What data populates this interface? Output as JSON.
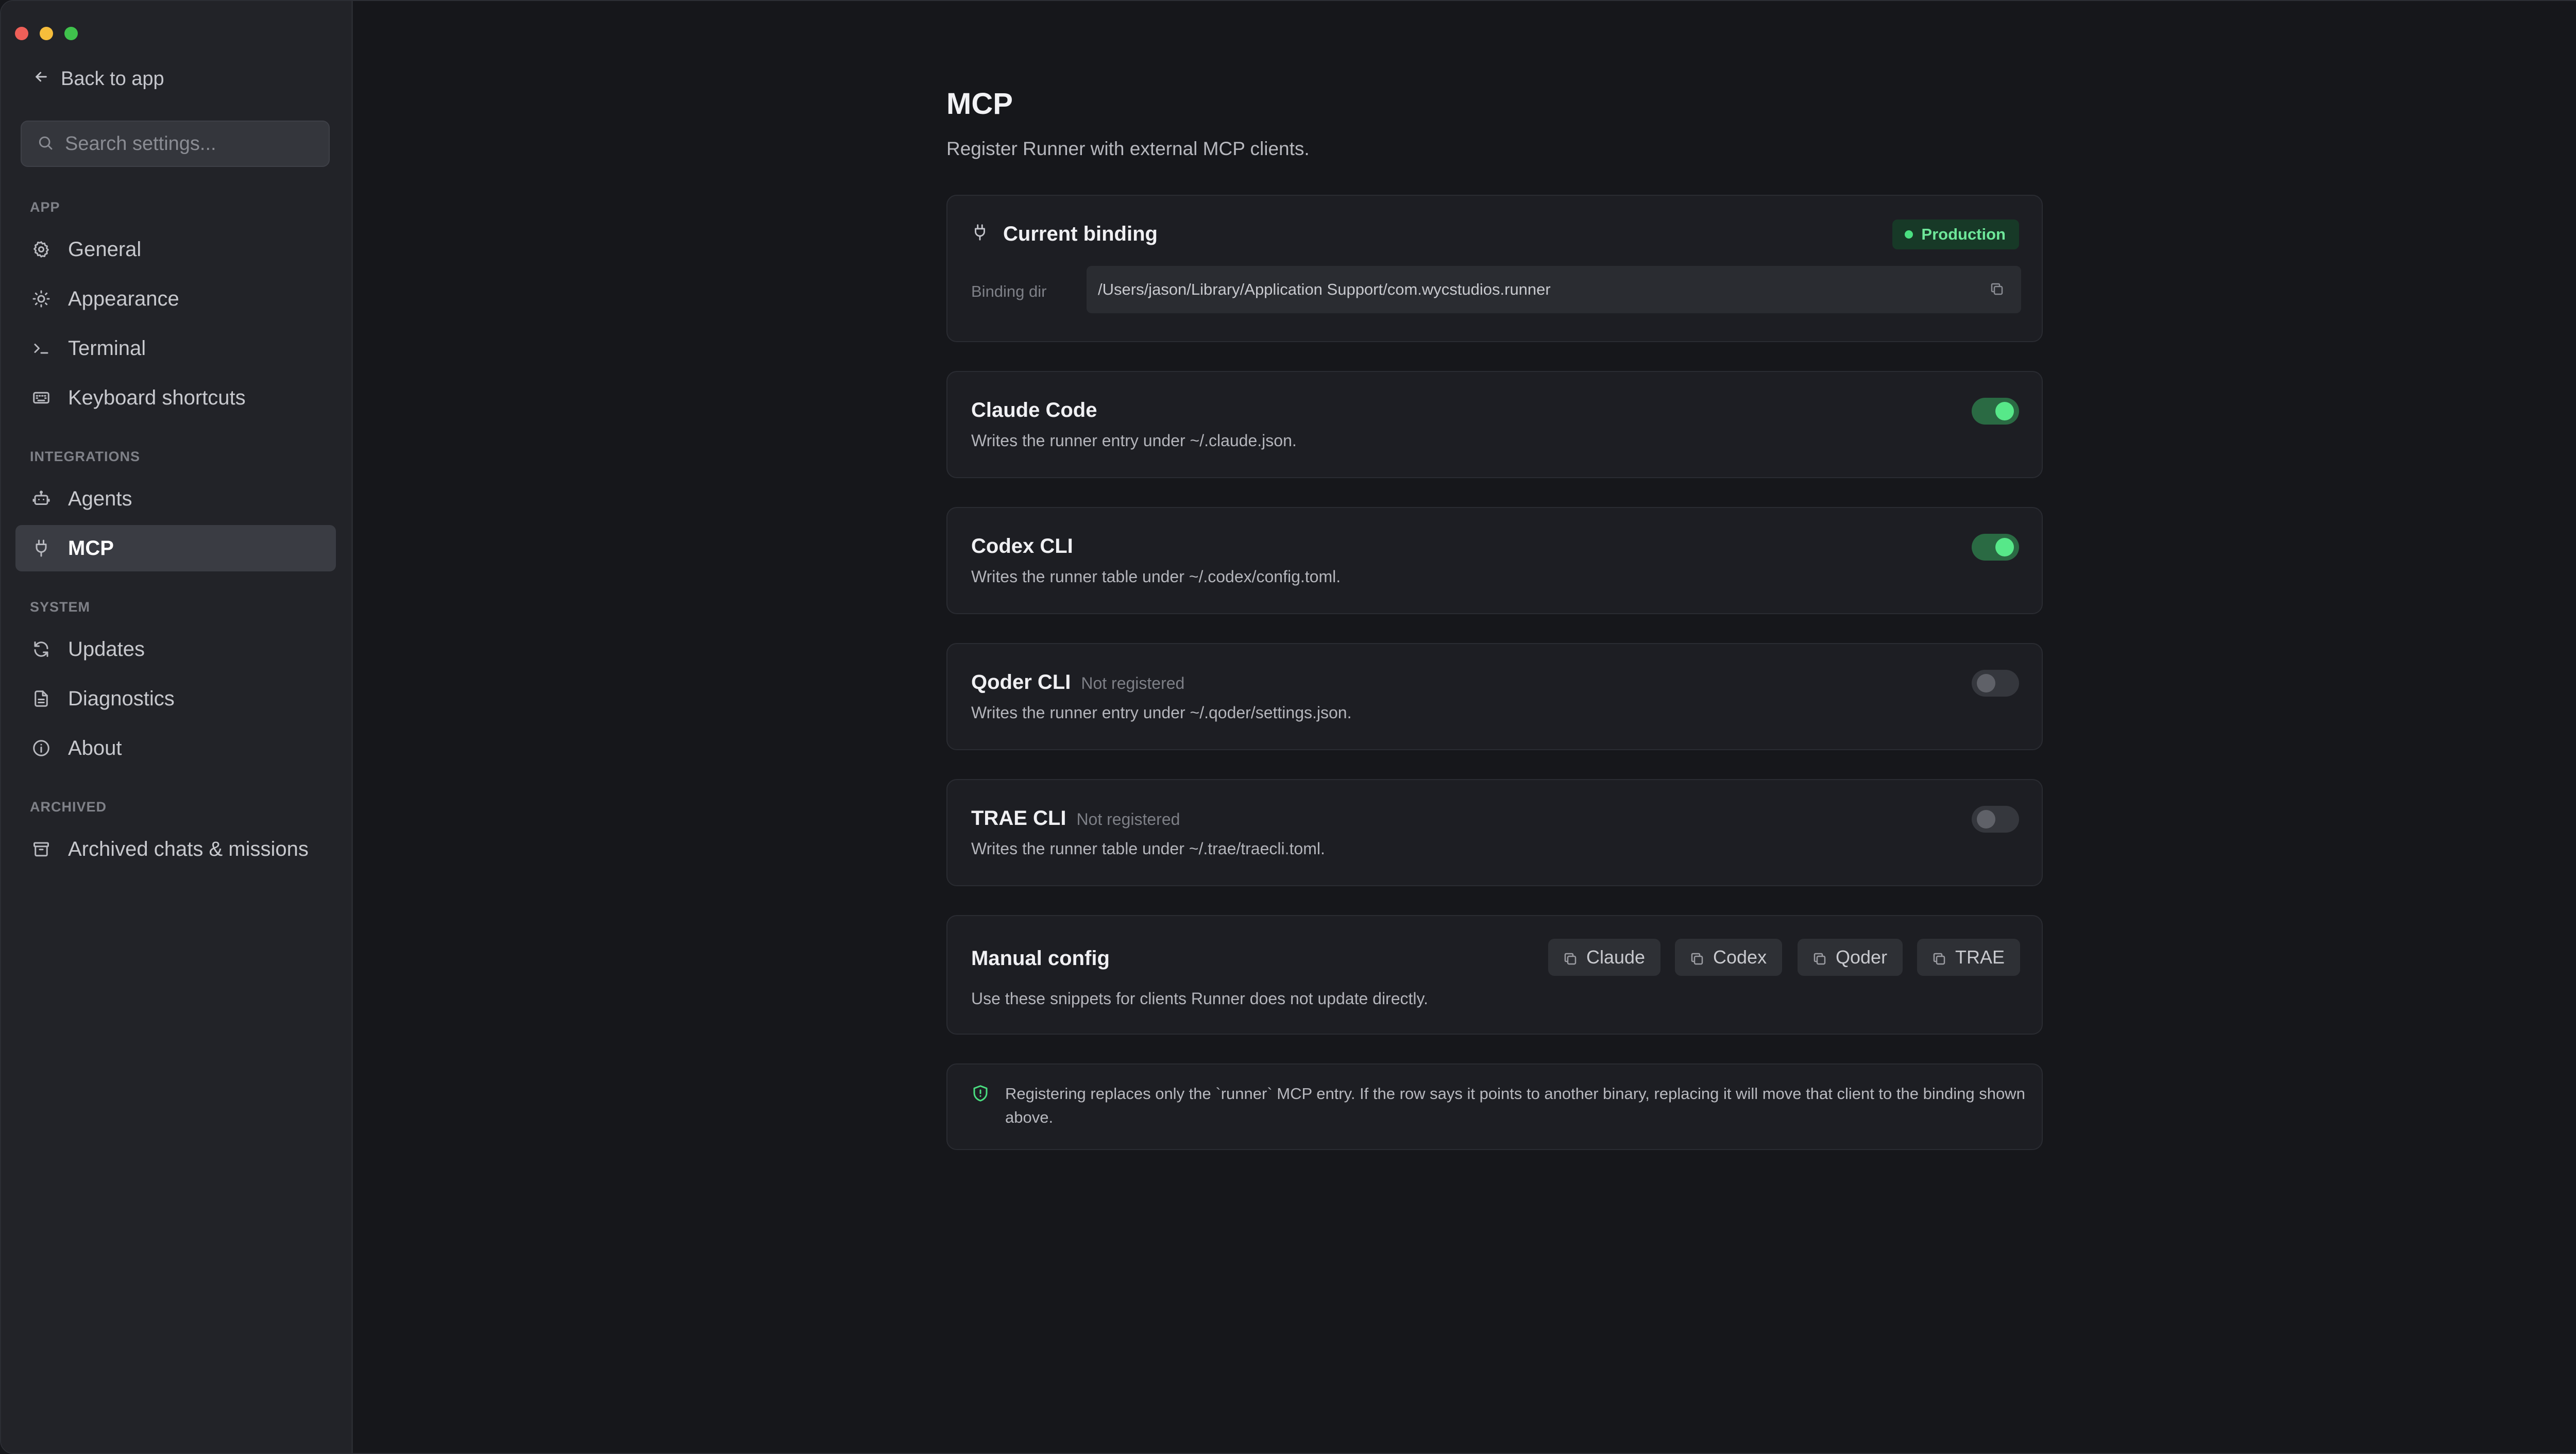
{
  "sidebar": {
    "back_label": "Back to app",
    "search_placeholder": "Search settings...",
    "sections": {
      "app": "APP",
      "integrations": "INTEGRATIONS",
      "system": "SYSTEM",
      "archived": "ARCHIVED"
    },
    "items": {
      "general": "General",
      "appearance": "Appearance",
      "terminal": "Terminal",
      "keyboard": "Keyboard shortcuts",
      "agents": "Agents",
      "mcp": "MCP",
      "updates": "Updates",
      "diagnostics": "Diagnostics",
      "about": "About",
      "archived_chats": "Archived chats & missions"
    },
    "active_item": "MCP"
  },
  "page": {
    "title": "MCP",
    "subtitle": "Register Runner with external MCP clients."
  },
  "binding": {
    "title": "Current binding",
    "badge": "Production",
    "dir_label": "Binding dir",
    "dir_value": "/Users/jason/Library/Application Support/com.wycstudios.runner"
  },
  "clients": [
    {
      "name": "Claude Code",
      "status": "",
      "desc": "Writes the runner entry under ~/.claude.json.",
      "enabled": true
    },
    {
      "name": "Codex CLI",
      "status": "",
      "desc": "Writes the runner table under ~/.codex/config.toml.",
      "enabled": true
    },
    {
      "name": "Qoder CLI",
      "status": "Not registered",
      "desc": "Writes the runner entry under ~/.qoder/settings.json.",
      "enabled": false
    },
    {
      "name": "TRAE CLI",
      "status": "Not registered",
      "desc": "Writes the runner table under ~/.trae/traecli.toml.",
      "enabled": false
    }
  ],
  "manual": {
    "title": "Manual config",
    "desc": "Use these snippets for clients Runner does not update directly.",
    "buttons": [
      "Claude",
      "Codex",
      "Qoder",
      "TRAE"
    ]
  },
  "note": {
    "text": "Registering replaces only the `runner` MCP entry. If the row says it points to another binary, replacing it will move that client to the binding shown above."
  },
  "colors": {
    "accent_green": "#57e889",
    "toggle_on": "#2a6a43",
    "badge_bg": "#173927"
  },
  "icons": {
    "back": "arrow-left-icon",
    "search": "search-icon",
    "general": "gear-icon",
    "appearance": "sun-icon",
    "terminal": "terminal-prompt-icon",
    "keyboard": "keyboard-icon",
    "agents": "robot-icon",
    "mcp": "plug-icon",
    "updates": "refresh-icon",
    "diagnostics": "document-icon",
    "about": "info-icon",
    "archived": "archive-box-icon",
    "copy": "copy-icon",
    "shield": "shield-icon"
  }
}
